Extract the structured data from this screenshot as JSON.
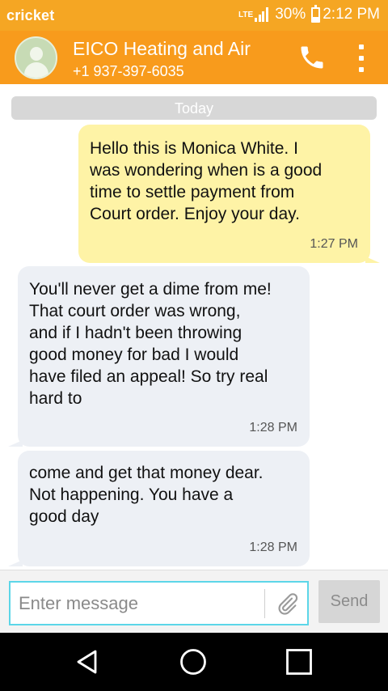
{
  "status_bar": {
    "carrier": "cricket",
    "network_type": "LTE",
    "battery": "30%",
    "battery_level": 0.3,
    "time": "2:12 PM"
  },
  "header": {
    "contact_name": "EICO Heating and Air",
    "contact_number": "+1 937-397-6035",
    "icons": [
      "avatar-person-icon",
      "phone-call-icon",
      "overflow-menu-icon"
    ]
  },
  "conversation": {
    "date_divider": "Today",
    "messages": [
      {
        "direction": "outgoing",
        "lines": [
          "Hello this is Monica White. I",
          "was wondering when is a good",
          "time to settle payment from",
          "Court order. Enjoy your day."
        ],
        "time": "1:27 PM"
      },
      {
        "direction": "incoming",
        "lines": [
          "You'll never get a dime from me!",
          "That court order was wrong,",
          "and if I hadn't been throwing",
          "good money for bad I would",
          "have filed an appeal! So try real",
          "hard to"
        ],
        "time": "1:28 PM"
      },
      {
        "direction": "incoming",
        "lines": [
          "come and get that money dear.",
          "Not happening. You have a",
          "good day"
        ],
        "time": "1:28 PM"
      }
    ]
  },
  "composer": {
    "placeholder": "Enter message",
    "value": "",
    "send_label": "Send",
    "icons": [
      "paperclip-icon"
    ]
  },
  "nav_bar": {
    "icons": [
      "back-triangle-icon",
      "home-circle-icon",
      "recents-square-icon"
    ]
  },
  "colors": {
    "status_bar": "#f5a623",
    "app_bar": "#f89b1c",
    "outgoing_bubble": "#fef3a6",
    "incoming_bubble": "#edf0f5",
    "field_focus": "#5cd6e8"
  }
}
